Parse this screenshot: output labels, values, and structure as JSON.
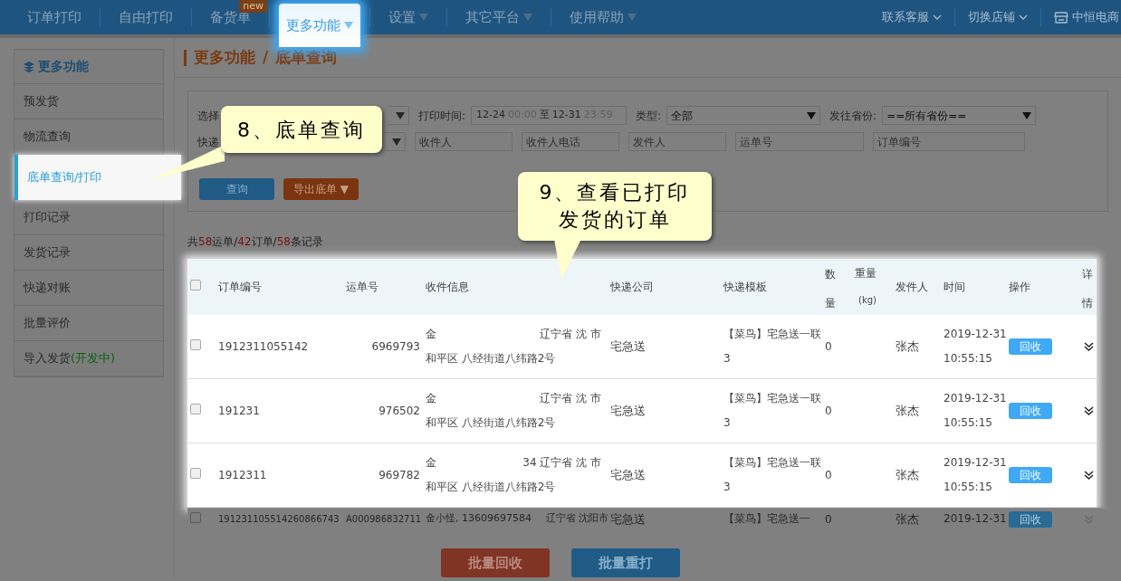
{
  "nav": {
    "items": [
      {
        "label": "订单打印",
        "caret": false,
        "selected": false
      },
      {
        "label": "自由打印",
        "caret": false,
        "selected": false
      },
      {
        "label": "备货单",
        "caret": false,
        "selected": false,
        "badge": "new"
      },
      {
        "label": "更多功能",
        "caret": true,
        "selected": true
      },
      {
        "label": "设置",
        "caret": true,
        "selected": false
      },
      {
        "label": "其它平台",
        "caret": true,
        "selected": false
      },
      {
        "label": "使用帮助",
        "caret": true,
        "selected": false
      }
    ],
    "right_links": [
      "联系客服",
      "切换店铺"
    ],
    "shop": "中恒电商"
  },
  "sidebar": {
    "title": "更多功能",
    "items": [
      {
        "label": "预发货",
        "selected": false
      },
      {
        "label": "物流查询",
        "selected": false
      },
      {
        "label": "底单查询/打印",
        "selected": true
      },
      {
        "label": "打印记录",
        "selected": false
      },
      {
        "label": "发货记录",
        "selected": false
      },
      {
        "label": "快递对账",
        "selected": false
      },
      {
        "label": "批量评价",
        "selected": false
      },
      {
        "label": "导入发货",
        "selected": false,
        "tag": "(开发中)"
      }
    ]
  },
  "breadcrumb": [
    "更多功能",
    "/",
    "底单查询"
  ],
  "filters": {
    "shop_label": "选择",
    "print_time_label": "打印时间:",
    "date_from": "12-24",
    "time_from": "00:00",
    "date_sep": "至",
    "date_to": "12-31",
    "time_to": "23:59",
    "type_label": "类型:",
    "type_value": "全部",
    "province_label": "发往省份:",
    "province_value": "==所有省份==",
    "express_label": "快递",
    "placeholders": [
      "收件人",
      "收件人电话",
      "发件人",
      "运单号",
      "订单编号"
    ],
    "query_button": "查询",
    "export_button": "导出底单 ▼"
  },
  "summary": [
    {
      "text": "共",
      "highlight": false
    },
    {
      "text": "58",
      "highlight": true
    },
    {
      "text": "运单/",
      "highlight": false
    },
    {
      "text": "42",
      "highlight": true
    },
    {
      "text": "订单/",
      "highlight": false
    },
    {
      "text": "58",
      "highlight": true
    },
    {
      "text": "条记录",
      "highlight": false
    }
  ],
  "table": {
    "header_checked": false,
    "columns": [
      "订单编号",
      "运单号",
      "收件信息",
      "快递公司",
      "快递模板",
      "数量",
      "重量",
      "(kg)",
      "发件人",
      "时间",
      "操作",
      "详情"
    ],
    "rows": [
      {
        "checked": false,
        "dimmed": false,
        "order_no": "1912311055142",
        "waybill": "6969793",
        "recipient_name": "金",
        "recipient_area": "辽宁省 沈 市",
        "address": "和平区 八经街道八纬路2号",
        "company": "宅急送",
        "template": "【菜鸟】宅急送一联3",
        "qty": "0",
        "sender": "张杰",
        "date": "2019-12-31",
        "time": "10:55:15",
        "action": "回收"
      },
      {
        "checked": false,
        "dimmed": false,
        "order_no": "191231",
        "waybill": "976502",
        "recipient_name": "金",
        "recipient_area": "辽宁省 沈 市",
        "address": "和平区 八经街道八纬路2号",
        "company": "宅急送",
        "template": "【菜鸟】宅急送一联3",
        "qty": "0",
        "sender": "张杰",
        "date": "2019-12-31",
        "time": "10:55:15",
        "action": "回收"
      },
      {
        "checked": false,
        "dimmed": false,
        "order_no": "1912311",
        "waybill": "969782",
        "recipient_name": "金",
        "recipient_area": "34 辽宁省 沈 市",
        "address": "和平区 八经街道八纬路2号",
        "company": "宅急送",
        "template": "【菜鸟】宅急送一联3",
        "qty": "0",
        "sender": "张杰",
        "date": "2019-12-31",
        "time": "10:55:15",
        "action": "回收"
      },
      {
        "checked": false,
        "dimmed": true,
        "order_no": "191231105514260866743",
        "waybill": "A000986832711",
        "recipient_name": "金小怪, 13609697584",
        "recipient_area": "辽宁省 沈阳市",
        "company": "宅急送",
        "template": "【菜鸟】宅急送一",
        "qty": "0",
        "sender": "张杰",
        "date": "2019-12-31",
        "action": "回收"
      }
    ]
  },
  "footer_buttons": [
    "批量回收",
    "批量重打"
  ],
  "callouts": [
    "8、底单查询",
    "9、查看已打印发货的订单"
  ]
}
